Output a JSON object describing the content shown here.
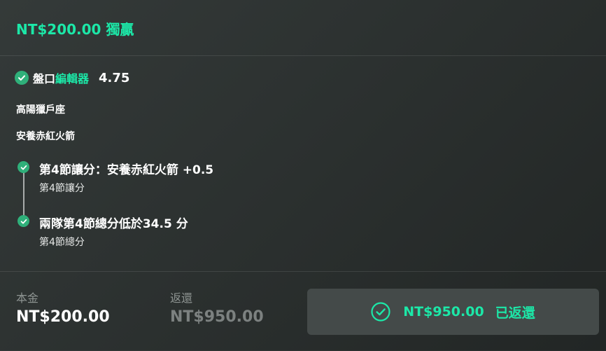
{
  "header": {
    "title": "NT$200.00 獨贏"
  },
  "bet": {
    "editor_prefix": "盤口",
    "editor_link": "編輯器",
    "odds": "4.75",
    "home_team": "高陽獵戶座",
    "away_team": "安養赤紅火箭"
  },
  "legs": [
    {
      "title": "第4節讓分：安養赤紅火箭 +0.5",
      "market": "第4節讓分",
      "status_icon": "check-icon"
    },
    {
      "title": "兩隊第4節總分低於34.5 分",
      "market": "第4節總分",
      "status_icon": "check-icon"
    }
  ],
  "footer": {
    "stake_label": "本金",
    "stake_value": "NT$200.00",
    "return_label": "返還",
    "return_value": "NT$950.00",
    "status_amount": "NT$950.00",
    "status_text": "已返還"
  },
  "colors": {
    "accent": "#1ce8a8",
    "check_green": "#2fb07a",
    "muted_text": "#8e9492",
    "pill_bg": "#444a49"
  }
}
